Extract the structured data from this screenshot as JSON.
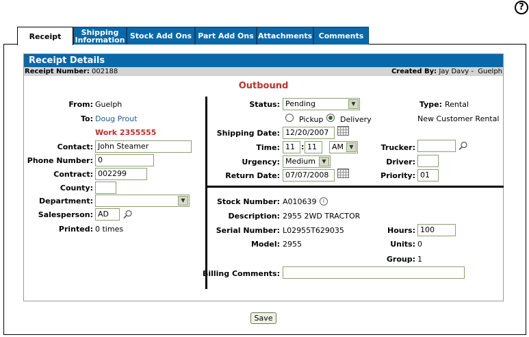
{
  "help_glyph": "?",
  "tabs": [
    {
      "label": "Receipt"
    },
    {
      "label": "Shipping\nInformation"
    },
    {
      "label": "Stock Add Ons"
    },
    {
      "label": "Part Add Ons"
    },
    {
      "label": "Attachments"
    },
    {
      "label": "Comments"
    }
  ],
  "panel": {
    "title": "Receipt Details",
    "receipt_number_label": "Receipt Number:",
    "receipt_number": "002188",
    "created_by_label": "Created By:",
    "created_by": "Jay Davy -  Guelph",
    "direction": "Outbound"
  },
  "left": {
    "from_label": "From:",
    "from": "Guelph",
    "to_label": "To:",
    "to": "Doug Prout",
    "work_order": "Work 2355555",
    "contact_label": "Contact:",
    "contact": "John Steamer",
    "phone_label": "Phone Number:",
    "phone": "0",
    "contract_label": "Contract:",
    "contract": "002299",
    "county_label": "County:",
    "county": "",
    "department_label": "Department:",
    "department": "",
    "salesperson_label": "Salesperson:",
    "salesperson": "AD",
    "printed_label": "Printed:",
    "printed": "0 times"
  },
  "status": {
    "status_label": "Status:",
    "status": "Pending",
    "type_label": "Type:",
    "type": "Rental",
    "customer_note": "New Customer Rental",
    "pickup_label": "Pickup",
    "delivery_label": "Delivery",
    "selected_mode": "Delivery",
    "shipping_date_label": "Shipping Date:",
    "shipping_date": "12/20/2007",
    "time_label": "Time:",
    "time_hour": "11",
    "time_sep": ":",
    "time_min": "11",
    "time_ampm": "AM",
    "trucker_label": "Trucker:",
    "trucker": "",
    "urgency_label": "Urgency:",
    "urgency": "Medium",
    "driver_label": "Driver:",
    "driver": "",
    "return_date_label": "Return Date:",
    "return_date": "07/07/2008",
    "priority_label": "Priority:",
    "priority": "01"
  },
  "stock": {
    "stock_number_label": "Stock Number:",
    "stock_number": "A010639",
    "info_glyph": "i",
    "description_label": "Description:",
    "description": "2955 2WD TRACTOR",
    "serial_label": "Serial Number:",
    "serial": "L02955T629035",
    "hours_label": "Hours:",
    "hours": "100",
    "model_label": "Model:",
    "model": "2955",
    "units_label": "Units:",
    "units": "0",
    "group_label": "Group:",
    "group": "1",
    "billing_comments_label": "Billing Comments:",
    "billing_comments": ""
  },
  "buttons": {
    "save": "Save"
  },
  "colors": {
    "tab_blue": "#0a68a8",
    "outbound_red": "#c0302a",
    "link_blue": "#1a5a9a"
  }
}
